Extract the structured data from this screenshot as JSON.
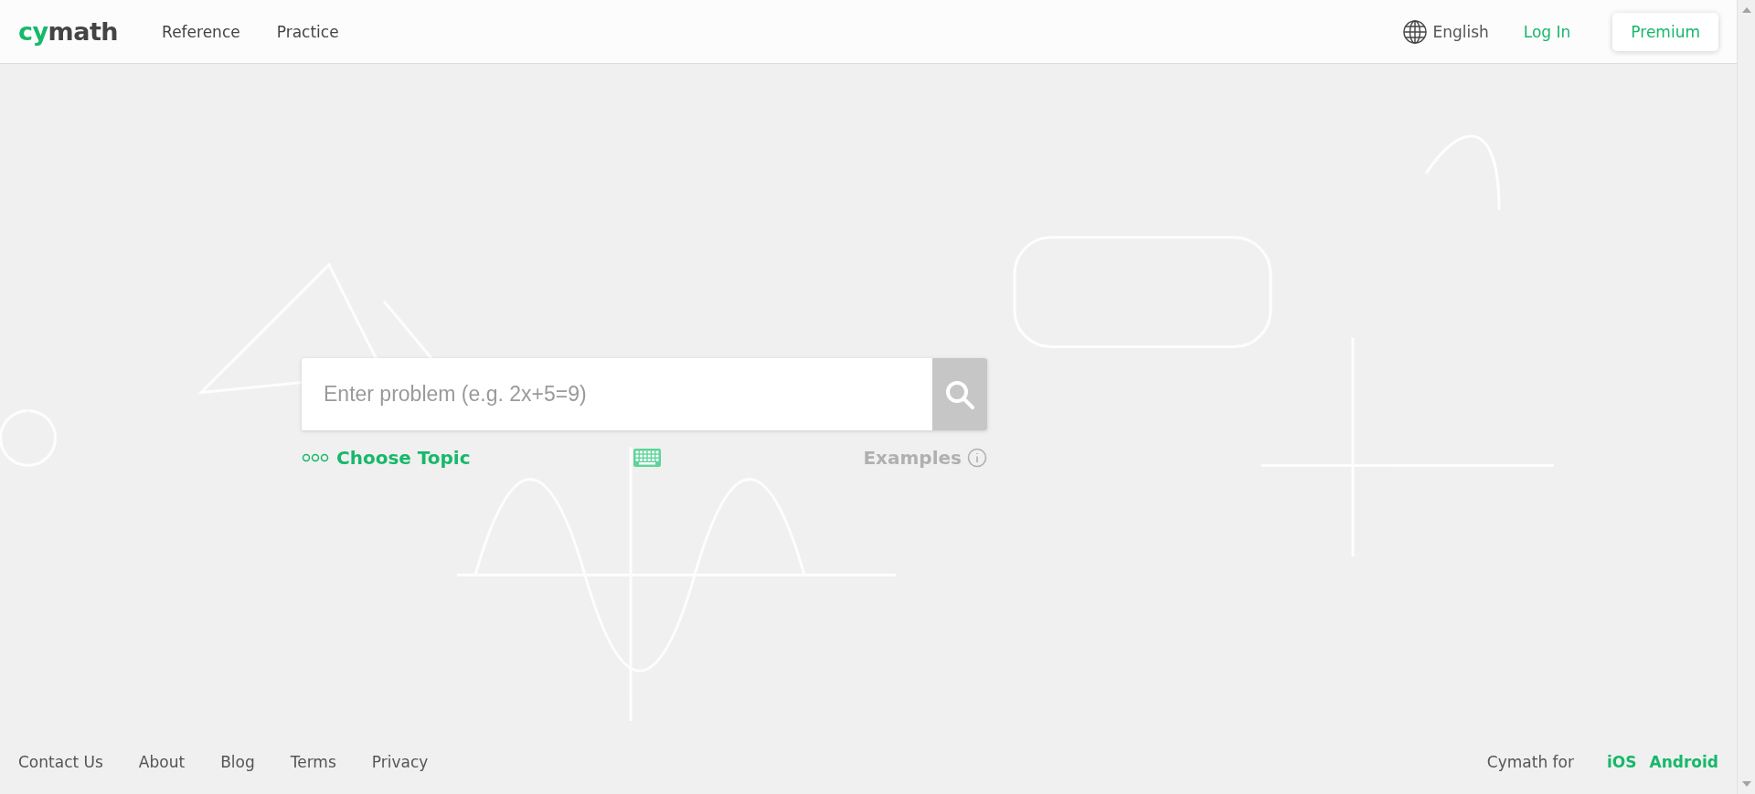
{
  "header": {
    "logo": {
      "accent": "cy",
      "rest": "math"
    },
    "nav": [
      {
        "label": "Reference"
      },
      {
        "label": "Practice"
      }
    ],
    "language": "English",
    "login": "Log In",
    "premium": "Premium"
  },
  "search": {
    "placeholder": "Enter problem (e.g. 2x+5=9)",
    "choose_topic": "Choose Topic",
    "examples": "Examples"
  },
  "footer": {
    "links": [
      {
        "label": "Contact Us"
      },
      {
        "label": "About"
      },
      {
        "label": "Blog"
      },
      {
        "label": "Terms"
      },
      {
        "label": "Privacy"
      }
    ],
    "apps_label": "Cymath for",
    "apps": [
      {
        "label": "iOS"
      },
      {
        "label": "Android"
      }
    ]
  }
}
